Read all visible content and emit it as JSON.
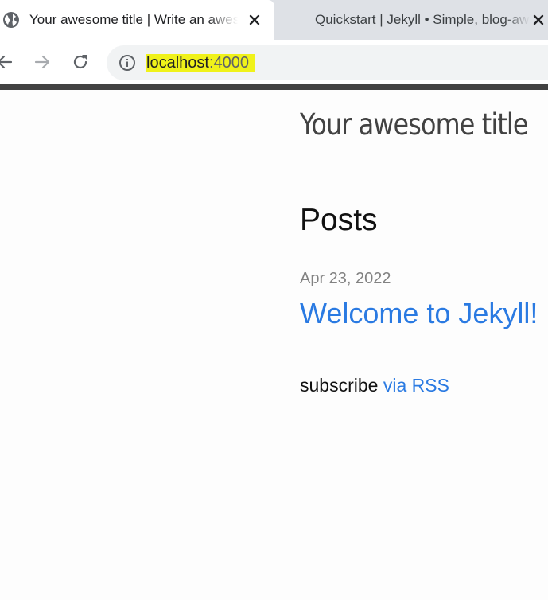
{
  "browser": {
    "tabs": [
      {
        "title": "Your awesome title | Write an awesome description",
        "icon": "globe-icon",
        "active": true,
        "close_label": "✕"
      },
      {
        "title": "Quickstart | Jekyll • Simple, blog-aware",
        "icon": "jekyll-test-tube-icon",
        "active": false,
        "close_label": "✕"
      }
    ],
    "toolbar": {
      "back_icon": "back-arrow-icon",
      "forward_icon": "forward-arrow-icon",
      "reload_icon": "reload-icon"
    },
    "address": {
      "info_icon": "info-icon",
      "host": "localhost",
      "port": ":4000",
      "highlight_color": "#f0f21a"
    }
  },
  "page": {
    "site_title": "Your awesome title",
    "posts_heading": "Posts",
    "posts": [
      {
        "date": "Apr 23, 2022",
        "title": "Welcome to Jekyll!"
      }
    ],
    "subscribe": {
      "prefix": "subscribe",
      "link_text": "via RSS"
    },
    "colors": {
      "link": "#2a7ae2",
      "topbar": "#424242",
      "meta": "#828282"
    }
  }
}
